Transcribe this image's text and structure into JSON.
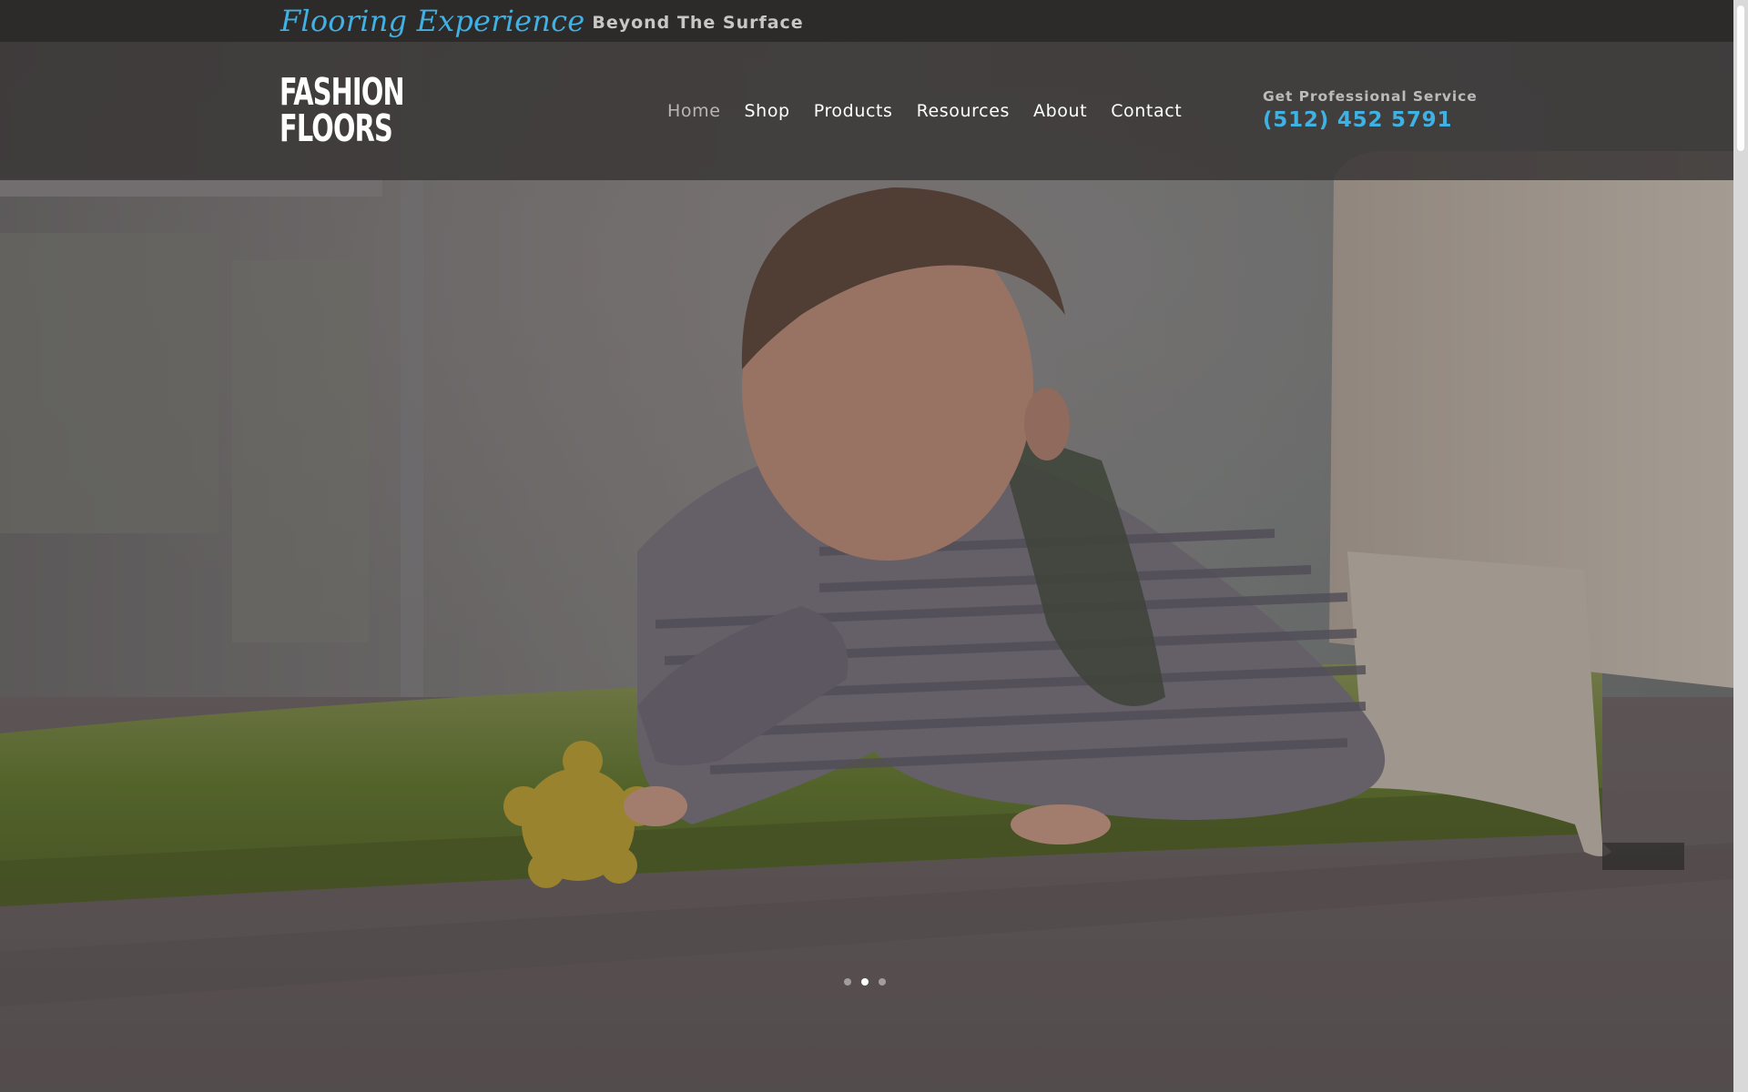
{
  "topbar": {
    "script_text": "Flooring Experience",
    "rest_text": "Beyond The Surface"
  },
  "logo": {
    "line1": "FASHION",
    "line2": "FLOORS"
  },
  "nav": {
    "items": [
      {
        "label": "Home",
        "active": true
      },
      {
        "label": "Shop",
        "active": false
      },
      {
        "label": "Products",
        "active": false
      },
      {
        "label": "Resources",
        "active": false
      },
      {
        "label": "About",
        "active": false
      },
      {
        "label": "Contact",
        "active": false
      }
    ]
  },
  "service": {
    "label": "Get Professional Service",
    "phone": "(512) 452 5791"
  },
  "slider": {
    "slide_count": 3,
    "active_index": 1
  },
  "colors": {
    "accent": "#3fb1e3",
    "topbar_bg": "#2d2a2a",
    "header_overlay": "#3a3737"
  }
}
